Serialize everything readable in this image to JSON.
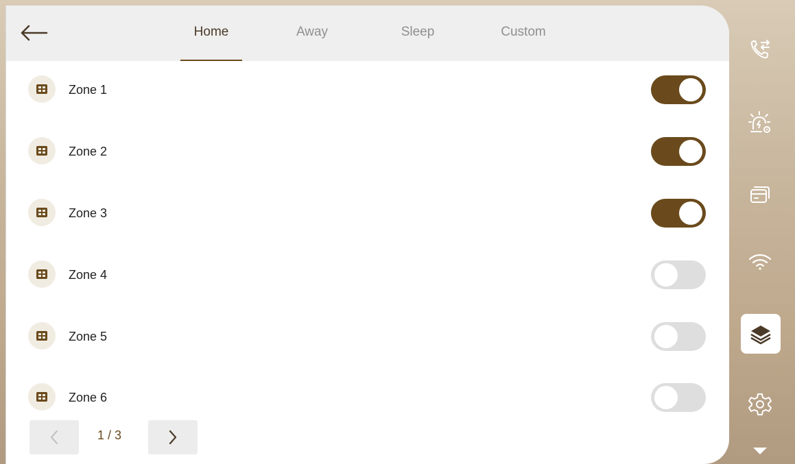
{
  "header": {
    "tabs": [
      {
        "label": "Home",
        "active": true
      },
      {
        "label": "Away",
        "active": false
      },
      {
        "label": "Sleep",
        "active": false
      },
      {
        "label": "Custom",
        "active": false
      }
    ]
  },
  "zones": [
    {
      "label": "Zone 1",
      "enabled": true
    },
    {
      "label": "Zone 2",
      "enabled": true
    },
    {
      "label": "Zone 3",
      "enabled": true
    },
    {
      "label": "Zone 4",
      "enabled": false
    },
    {
      "label": "Zone 5",
      "enabled": false
    },
    {
      "label": "Zone 6",
      "enabled": false
    }
  ],
  "pager": {
    "text": "1 / 3"
  },
  "sidebar": {
    "items": [
      {
        "icon": "phone-transfer-icon",
        "active": false
      },
      {
        "icon": "alarm-settings-icon",
        "active": false
      },
      {
        "icon": "cards-icon",
        "active": false
      },
      {
        "icon": "wifi-icon",
        "active": false
      },
      {
        "icon": "layers-icon",
        "active": true
      },
      {
        "icon": "gear-icon",
        "active": false
      },
      {
        "icon": "caret-down-icon",
        "active": false
      }
    ]
  },
  "colors": {
    "accent": "#6a4a1c",
    "toggle_off": "#dedede",
    "zone_icon_bg": "#f1ece2",
    "topbar_bg": "#efefef"
  }
}
